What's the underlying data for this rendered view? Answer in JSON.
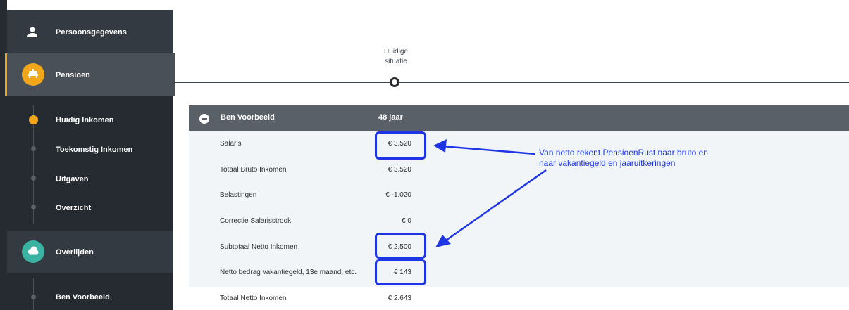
{
  "sidebar": {
    "sections": [
      {
        "label": "Persoonsgegevens",
        "icon": "person-icon"
      },
      {
        "label": "Pensioen",
        "icon": "beach-chair-icon",
        "color": "#f2a71b"
      },
      {
        "label": "Overlijden",
        "icon": "cloud-icon",
        "color": "#3ab3a3"
      }
    ],
    "pensioen_items": [
      "Huidig Inkomen",
      "Toekomstig Inkomen",
      "Uitgaven",
      "Overzicht"
    ],
    "overlijden_items": [
      "Ben Voorbeeld"
    ]
  },
  "timeline": {
    "label": "Huidige\nsituatie"
  },
  "person": {
    "name": "Ben Voorbeeld",
    "age": "48 jaar"
  },
  "rows": [
    {
      "label": "Salaris",
      "value": "€ 3.520"
    },
    {
      "label": "Totaal Bruto Inkomen",
      "value": "€ 3.520"
    },
    {
      "label": "Belastingen",
      "value": "€ -1.020"
    },
    {
      "label": "Correctie Salarisstrook",
      "value": "€ 0"
    },
    {
      "label": "Subtotaal Netto Inkomen",
      "value": "€ 2.500"
    },
    {
      "label": "Netto bedrag vakantiegeld, 13e maand, etc.",
      "value": "€ 143"
    },
    {
      "label": "Totaal Netto Inkomen",
      "value": "€ 2.643"
    }
  ],
  "annotation": {
    "line1": "Van netto rekent PensioenRust naar bruto en",
    "line2": "naar vakantiegeld en jaaruitkeringen"
  },
  "colors": {
    "accent": "#f2a71b",
    "highlight": "#1d35e5",
    "sidebar": "#262b31"
  }
}
